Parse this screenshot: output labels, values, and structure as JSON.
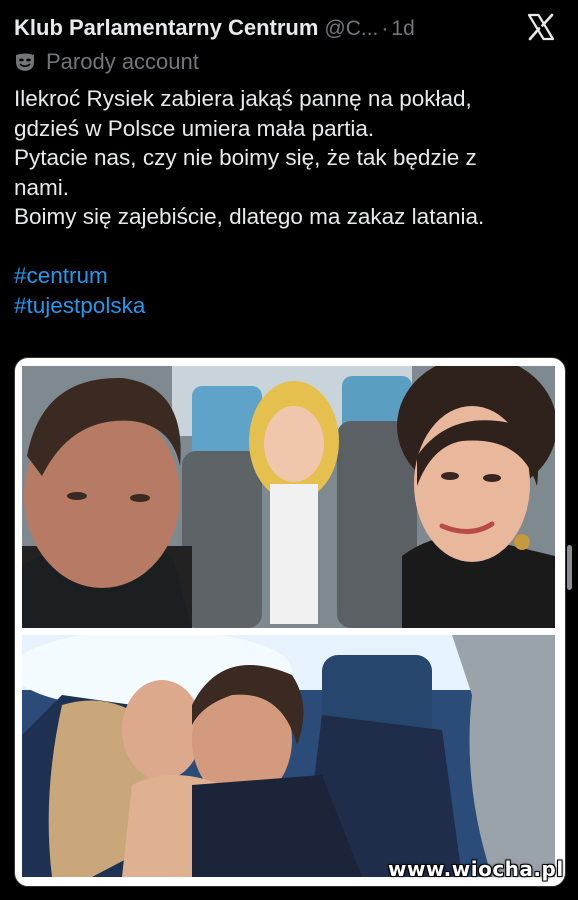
{
  "tweet": {
    "author_name": "Klub Parlamentarny Centrum",
    "author_handle": "@C...",
    "separator": "·",
    "time_ago": "1d",
    "parody_label": "Parody account",
    "lines": [
      "Ilekroć Rysiek zabiera jakąś pannę na pokład,",
      "gdzieś w Polsce umiera mała partia.",
      "Pytacie nas, czy nie boimy się, że tak będzie z",
      "nami.",
      "Boimy się zajebiście, dlatego ma zakaz latania."
    ],
    "hashtags": [
      "#centrum",
      "#tujestpolska"
    ]
  },
  "icons": {
    "platform": "x-logo-icon",
    "parody": "parody-mask-icon"
  },
  "colors": {
    "background": "#000000",
    "text": "#e7e9ea",
    "secondary": "#71767b",
    "hashtag": "#1d9bf0"
  },
  "watermark": "www.wiocha.pl"
}
